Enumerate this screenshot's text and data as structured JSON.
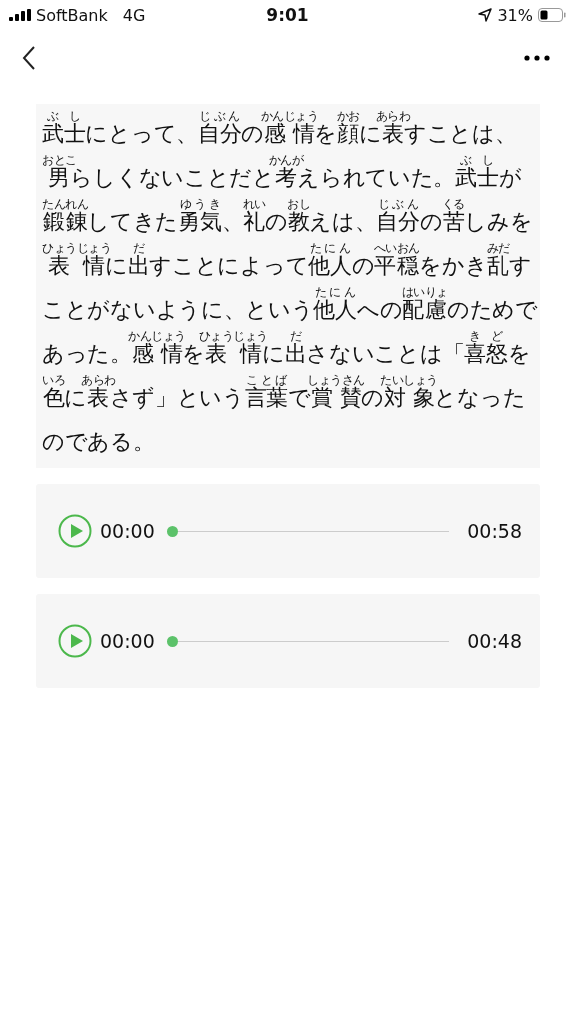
{
  "status_bar": {
    "carrier": "SoftBank",
    "network": "4G",
    "time": "9:01",
    "battery": "31%"
  },
  "passage": [
    {
      "text": "武士",
      "reading": "ぶし"
    },
    {
      "text": "にとって、"
    },
    {
      "text": "自分",
      "reading": "じぶん"
    },
    {
      "text": "の"
    },
    {
      "text": "感情",
      "reading": "かんじょう"
    },
    {
      "text": "を"
    },
    {
      "text": "顔",
      "reading": "かお"
    },
    {
      "text": "に"
    },
    {
      "text": "表",
      "reading": "あらわ"
    },
    {
      "text": "すことは、"
    },
    {
      "text": "男",
      "reading": "おとこ"
    },
    {
      "text": "らしくないことだと"
    },
    {
      "text": "考",
      "reading": "かんが"
    },
    {
      "text": "えられていた。"
    },
    {
      "text": "武士",
      "reading": "ぶし"
    },
    {
      "text": "が"
    },
    {
      "text": "鍛錬",
      "reading": "たんれん"
    },
    {
      "text": "してきた"
    },
    {
      "text": "勇気",
      "reading": "ゆうき"
    },
    {
      "text": "、"
    },
    {
      "text": "礼",
      "reading": "れい"
    },
    {
      "text": "の"
    },
    {
      "text": "教",
      "reading": "おし"
    },
    {
      "text": "えは、"
    },
    {
      "text": "自分",
      "reading": "じぶん"
    },
    {
      "text": "の"
    },
    {
      "text": "苦",
      "reading": "くる"
    },
    {
      "text": "しみを"
    },
    {
      "text": "表情",
      "reading": "ひょうじょう"
    },
    {
      "text": "に"
    },
    {
      "text": "出",
      "reading": "だ"
    },
    {
      "text": "すことによって"
    },
    {
      "text": "他人",
      "reading": "たにん"
    },
    {
      "text": "の"
    },
    {
      "text": "平穏",
      "reading": "へいおん"
    },
    {
      "text": "をかき"
    },
    {
      "text": "乱",
      "reading": "みだ"
    },
    {
      "text": "すことがないように、という"
    },
    {
      "text": "他人",
      "reading": "たにん"
    },
    {
      "text": "への"
    },
    {
      "text": "配慮",
      "reading": "はいりょ"
    },
    {
      "text": "のためであった。"
    },
    {
      "text": "感情",
      "reading": "かんじょう"
    },
    {
      "text": "を"
    },
    {
      "text": "表情",
      "reading": "ひょうじょう"
    },
    {
      "text": "に"
    },
    {
      "text": "出",
      "reading": "だ"
    },
    {
      "text": "さないことは「"
    },
    {
      "text": "喜怒",
      "reading": "きど"
    },
    {
      "text": "を"
    },
    {
      "text": "色",
      "reading": "いろ"
    },
    {
      "text": "に"
    },
    {
      "text": "表",
      "reading": "あらわ"
    },
    {
      "text": "さず」という"
    },
    {
      "text": "言葉",
      "reading": "ことば"
    },
    {
      "text": "で"
    },
    {
      "text": "賞賛",
      "reading": "しょうさん"
    },
    {
      "text": "の"
    },
    {
      "text": "対象",
      "reading": "たいしょう"
    },
    {
      "text": "となったのである。"
    }
  ],
  "audio_players": [
    {
      "current_time": "00:00",
      "duration": "00:58",
      "level": 0
    },
    {
      "current_time": "00:00",
      "duration": "00:48",
      "level": 0
    }
  ]
}
